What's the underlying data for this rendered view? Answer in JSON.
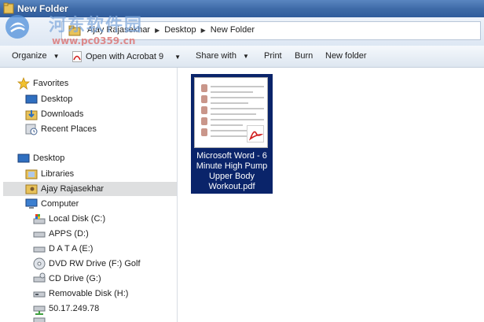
{
  "window": {
    "title": "New Folder"
  },
  "watermark": {
    "site_name_cn": "河东软件园",
    "url": "www.pc0359.cn"
  },
  "address_bar": {
    "breadcrumbs": [
      "Ajay Rajasekhar",
      "Desktop",
      "New Folder"
    ]
  },
  "toolbar": {
    "organize": "Organize",
    "open_with": "Open with Acrobat 9",
    "share_with": "Share with",
    "print": "Print",
    "burn": "Burn",
    "new_folder": "New folder"
  },
  "nav": {
    "favorites_header": "Favorites",
    "favorites": [
      {
        "label": "Desktop",
        "icon": "desktop-icon"
      },
      {
        "label": "Downloads",
        "icon": "downloads-icon"
      },
      {
        "label": "Recent Places",
        "icon": "recent-places-icon"
      }
    ],
    "desktop_header": "Desktop",
    "libraries": "Libraries",
    "user": "Ajay Rajasekhar",
    "computer": "Computer",
    "drives": [
      {
        "label": "Local Disk (C:)",
        "icon": "local-disk-icon"
      },
      {
        "label": "APPS (D:)",
        "icon": "drive-icon"
      },
      {
        "label": "D A T A (E:)",
        "icon": "drive-icon"
      },
      {
        "label": "DVD RW Drive (F:) Golf",
        "icon": "dvd-icon"
      },
      {
        "label": "CD Drive (G:)",
        "icon": "cd-icon"
      },
      {
        "label": "Removable Disk (H:)",
        "icon": "removable-disk-icon"
      },
      {
        "label": "50.17.249.78",
        "icon": "network-drive-icon"
      }
    ]
  },
  "files": [
    {
      "name_lines": [
        "Microsoft Word - 6",
        "Minute High Pump",
        "Upper Body",
        "Workout.pdf"
      ],
      "icon": "pdf-icon",
      "selected": true
    }
  ],
  "colors": {
    "title_bar": "#3f6ba8",
    "selection": "#0a246a",
    "nav_selected": "#dedfe0",
    "pdf_red": "#d11f1f"
  }
}
